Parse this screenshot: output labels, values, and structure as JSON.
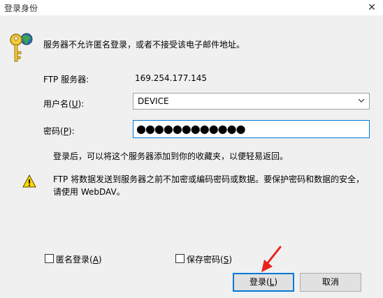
{
  "window": {
    "title": "登录身份",
    "close_glyph": "✕"
  },
  "message": "服务器不允许匿名登录，或者不接受该电子邮件地址。",
  "server": {
    "label": "FTP 服务器:",
    "value": "169.254.177.145"
  },
  "username": {
    "label_pre": "用户名(",
    "label_key": "U",
    "label_post": "):",
    "value": "DEVICE"
  },
  "password": {
    "label_pre": "密码(",
    "label_key": "P",
    "label_post": "):",
    "value": "●●●●●●●●●●●●"
  },
  "info": "登录后，可以将这个服务器添加到你的收藏夹，以便轻易返回。",
  "warning": "FTP 将数据发送到服务器之前不加密或编码密码或数据。要保护密码和数据的安全，请使用 WebDAV。",
  "anonymous": {
    "pre": "匿名登录(",
    "key": "A",
    "post": ")",
    "checked": false
  },
  "save_password": {
    "pre": "保存密码(",
    "key": "S",
    "post": ")",
    "checked": false
  },
  "buttons": {
    "login_pre": "登录(",
    "login_key": "L",
    "login_post": ")",
    "cancel": "取消"
  },
  "colors": {
    "accent": "#0078d7",
    "warning": "#ffd700",
    "annotation_arrow": "#e8221b"
  },
  "icons": {
    "keys": "keys-icon",
    "warning": "warning-icon",
    "dropdown": "chevron-down-icon"
  }
}
